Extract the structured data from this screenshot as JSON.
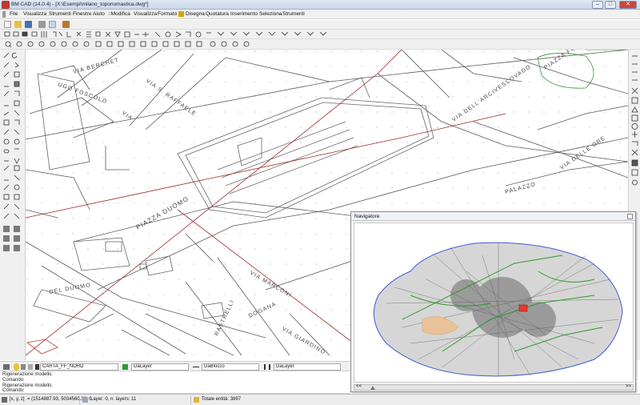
{
  "window": {
    "title": "BM CAD (14.0.4) - [X:\\Esempi\\milano_toponomastica.dwg*]",
    "minimize": "–",
    "maximize": "□",
    "close": "✕"
  },
  "menu": {
    "items_left": [
      "File",
      "Visualizza",
      "Strumenti",
      "Finestre",
      "Aiuto"
    ],
    "items_right": [
      "::Modifica",
      "Visualizza",
      "Formato",
      "Disegna",
      "Quotatura",
      "Inserimento",
      "Seleziona",
      "Strumenti"
    ]
  },
  "map_labels": {
    "via_berchet": "VIA BERCHET",
    "via_s_raffaele": "VIA S. RAFFAELE",
    "ugo_foscolo": "UGO FOSCOLO",
    "via_ugo": "VIA",
    "via_dell_arcivescovado": "VIA DELL'ARCIVESCOVADO",
    "piazza_fontana": "PIAZZA FONTANA",
    "via_delle_ore": "VIA DELLE ORE",
    "piazza_duomo": "PIAZZA DUOMO",
    "palazzo": "PALAZZO",
    "via_marconi": "VIA MARCONI",
    "dogana": "DOGANA",
    "via_dogana": "VIA",
    "rastrelli": "RASTRELLI",
    "via_rastrelli": "VIA",
    "via_giardino": "VIA GIARDINO",
    "del_duomo": "DEL DUOMO",
    "via_del_duomo": "VIA",
    "via_bassa": "VIA"
  },
  "navigator": {
    "title": "Navigatore",
    "scroll_left": "<<",
    "scroll_right": ">>"
  },
  "layer_bar": {
    "current_layer": "CARTA_FF_NORD",
    "color": "DaLayer",
    "linetype": "DaBlocco",
    "lineweight": "DaLayer"
  },
  "command_lines": [
    "Rigenerazione modello.",
    "Comando:",
    "Rigenerazione modello.",
    "Comando:"
  ],
  "status": {
    "coord_label": "[x, y, z]",
    "coords": "= (1514887.93, 5034560.38, 0",
    "layer_info": "Layer: 0, n. layers: 11",
    "entities": "Totale entità: 3897"
  },
  "colors": {
    "window_bg": "#f0f0f0",
    "drawing_bg": "#ffffff",
    "street_line": "#555555",
    "red_axis": "#9b2a2a",
    "green_parks": "#2e9a2e",
    "blue_outline": "#3b5bd6"
  }
}
